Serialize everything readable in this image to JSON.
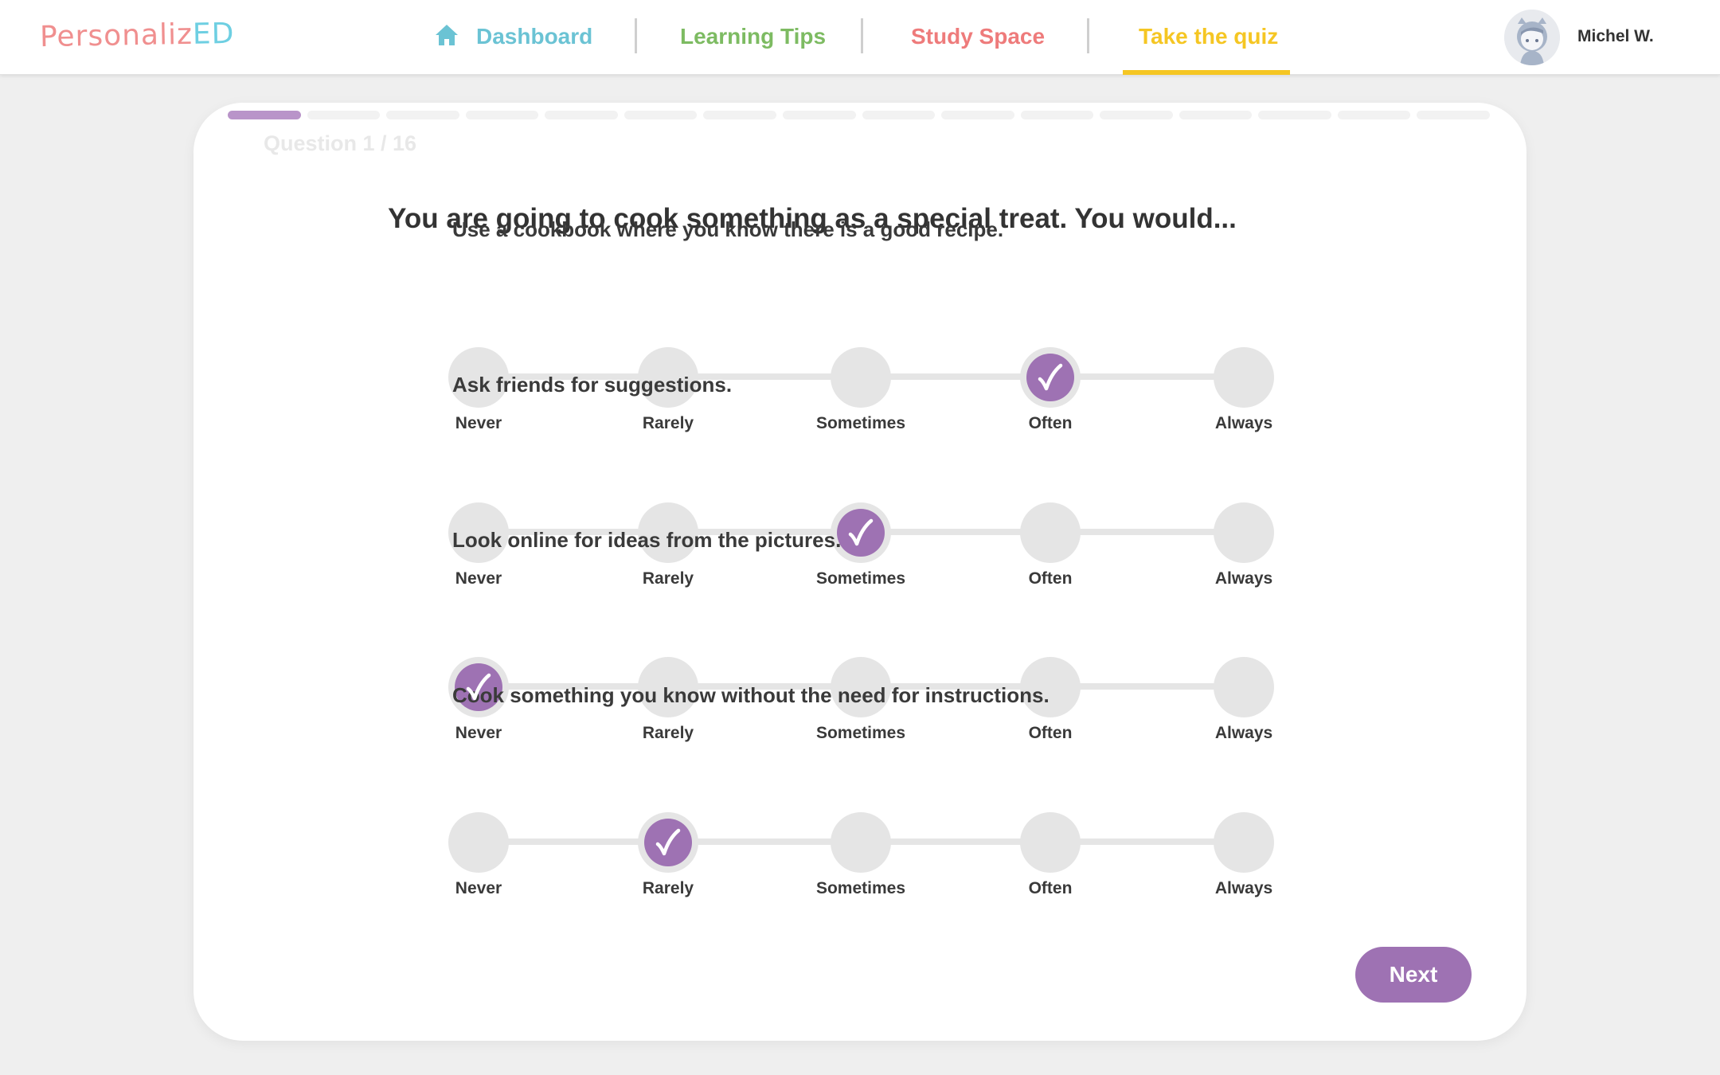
{
  "header": {
    "logo": {
      "part1": "Personaliz",
      "part2": "ED"
    },
    "nav": [
      {
        "label": "Dashboard",
        "icon": "home-icon",
        "color": "#6bc3d4"
      },
      {
        "label": "Learning Tips",
        "color": "#7dbb62"
      },
      {
        "label": "Study Space",
        "color": "#ee7b7b"
      },
      {
        "label": "Take the quiz",
        "color": "#f5c623",
        "active": true
      }
    ],
    "user": {
      "name": "Michel W.",
      "avatar": "avatar-icon"
    }
  },
  "quiz": {
    "progress": {
      "current": 1,
      "total": 16
    },
    "counter": "Question 1 / 16",
    "question": "You are going to cook something as a special treat. You would...",
    "scale_options": [
      "Never",
      "Rarely",
      "Sometimes",
      "Often",
      "Always"
    ],
    "items": [
      {
        "label": "Use a cookbook where you know there is a good recipe.",
        "selected": "Often"
      },
      {
        "label": "Ask friends for suggestions.",
        "selected": "Sometimes"
      },
      {
        "label": "Look online for ideas from the pictures.",
        "selected": "Never"
      },
      {
        "label": "Cook something you know without the need for instructions.",
        "selected": "Rarely"
      }
    ],
    "next_label": "Next",
    "accent_color": "#9e72b3"
  }
}
